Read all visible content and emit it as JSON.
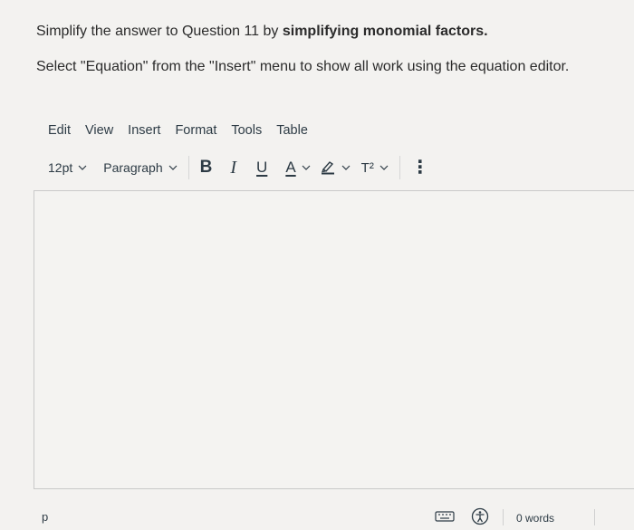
{
  "question": {
    "line1_prefix": "Simplify the answer to Question 11 by ",
    "line1_bold": "simplifying monomial factors.",
    "line2": "Select \"Equation\" from the \"Insert\" menu to show all work using the equation editor."
  },
  "menubar": {
    "items": [
      "Edit",
      "View",
      "Insert",
      "Format",
      "Tools",
      "Table"
    ]
  },
  "toolbar": {
    "font_size": "12pt",
    "block_format": "Paragraph",
    "bold": "B",
    "italic": "I",
    "underline": "U",
    "text_color": "A",
    "superscript": "T²",
    "more": "⋮"
  },
  "statusbar": {
    "path": "p",
    "word_count_partial": "0 words"
  },
  "colors": {
    "background": "#f3f2f0",
    "text": "#2d3b45",
    "border": "#c9c9c9"
  }
}
